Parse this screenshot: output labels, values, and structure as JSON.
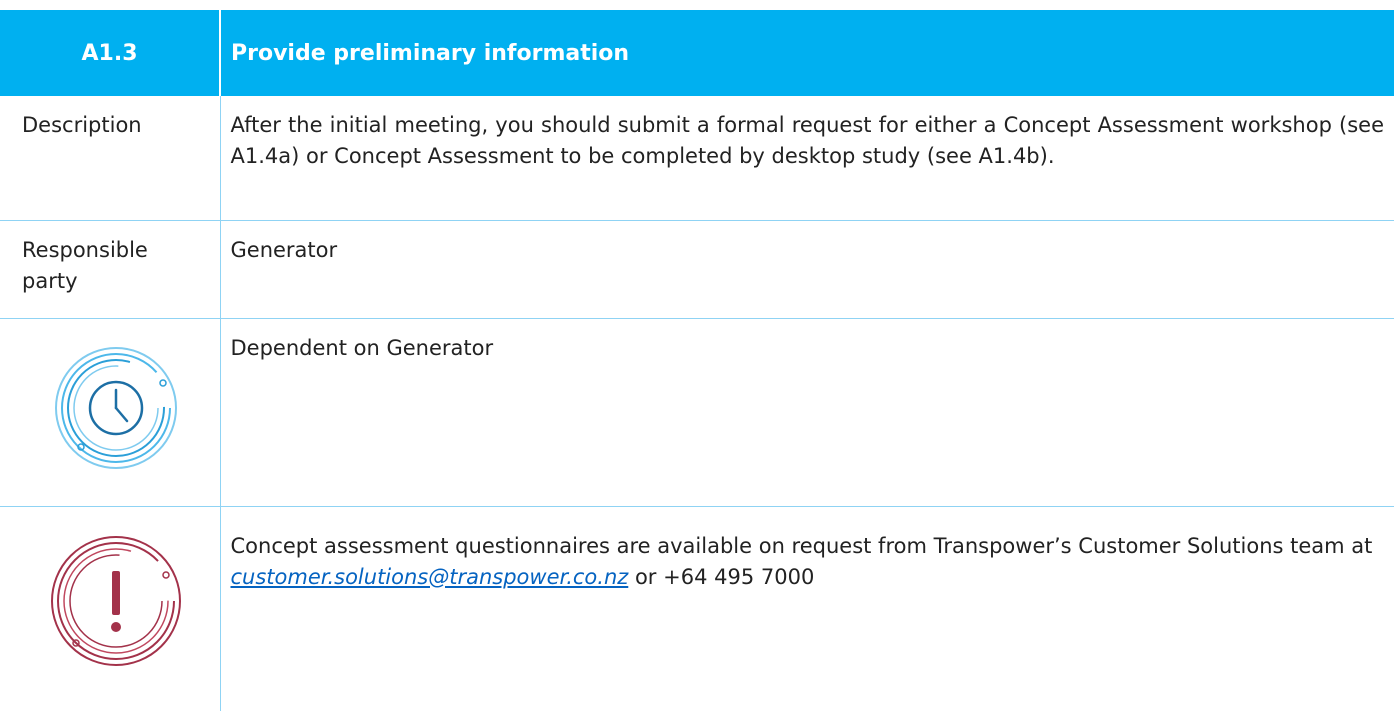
{
  "header": {
    "code": "A1.3",
    "title": "Provide preliminary information"
  },
  "description": {
    "label": "Description",
    "text": "After the initial meeting, you should submit a formal request for either a Concept Assessment workshop (see A1.4a) or Concept Assessment to be completed by desktop study (see A1.4b)."
  },
  "responsible": {
    "label_line1": "Responsible",
    "label_line2": "party",
    "value": "Generator"
  },
  "timing": {
    "icon": "clock-icon",
    "text": "Dependent on Generator"
  },
  "note": {
    "icon": "exclamation-icon",
    "text_before": "Concept assessment questionnaires are available on request from Transpower’s Customer Solutions team at ",
    "email": "customer.solutions@transpower.co.nz",
    "text_after": " or +64 495 7000"
  },
  "colors": {
    "header_bg": "#00b0f0",
    "clock_icon": "#2b9fd8",
    "alert_icon": "#a3324a",
    "link": "#0563c1",
    "border": "#8fd3f4"
  }
}
